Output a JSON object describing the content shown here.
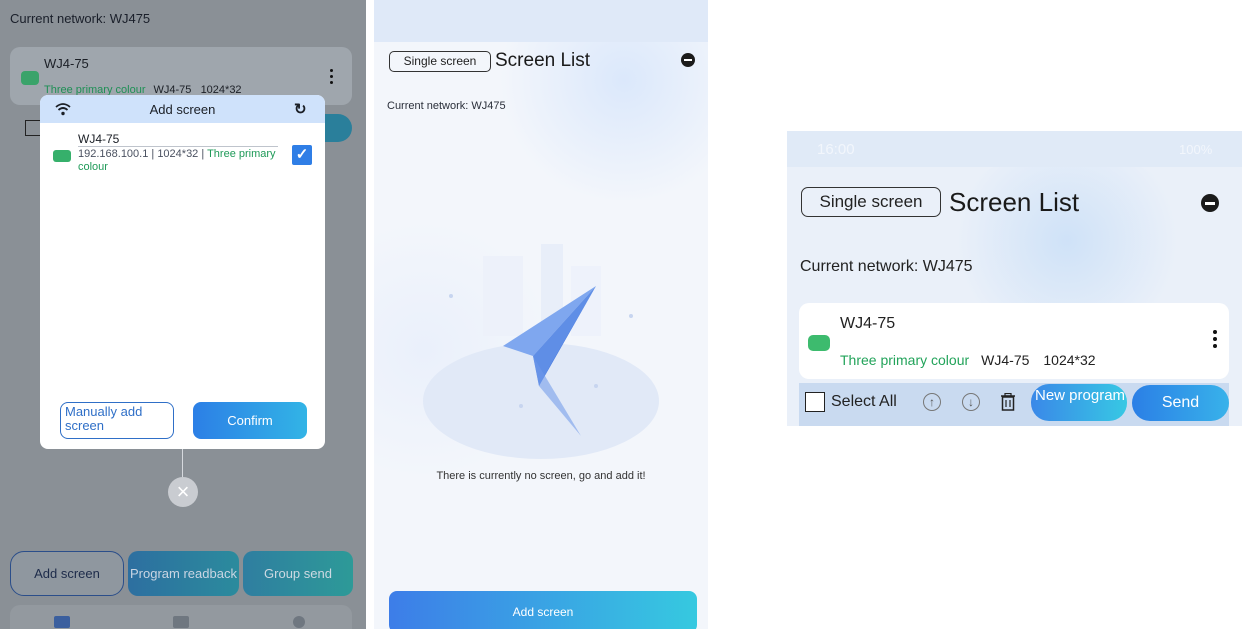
{
  "panel1": {
    "current_network": "Current network: WJ475",
    "card": {
      "name": "WJ4-75",
      "color_type": "Three primary colour",
      "model": "WJ4-75",
      "resolution": "1024*32"
    },
    "dialog": {
      "title": "Add screen",
      "item": {
        "name": "WJ4-75",
        "info_prefix": "192.168.100.1 | 1024*32 | ",
        "info_color": "Three primary colour",
        "checked": true
      },
      "manual_button": "Manually add screen",
      "confirm_button": "Confirm"
    },
    "bottom_buttons": {
      "add": "Add screen",
      "readback": "Program readback",
      "group_send": "Group send"
    }
  },
  "panel2": {
    "single_screen": "Single screen",
    "title": "Screen List",
    "current_network": "Current network: WJ475",
    "empty_message": "There is currently no screen, go and add it!",
    "add_button": "Add screen"
  },
  "panel3": {
    "status_time": "16:00",
    "status_battery": "100%",
    "single_screen": "Single screen",
    "title": "Screen List",
    "current_network": "Current network: WJ475",
    "card": {
      "name": "WJ4-75",
      "color_type": "Three primary colour",
      "model": "WJ4-75",
      "resolution": "1024*32"
    },
    "toolbar": {
      "select_all": "Select All",
      "new_program": "New program",
      "send": "Send"
    }
  },
  "colors": {
    "accent_blue": "#2f7ee6",
    "accent_green": "#22a35a",
    "gradient_end": "#36c9e0"
  }
}
